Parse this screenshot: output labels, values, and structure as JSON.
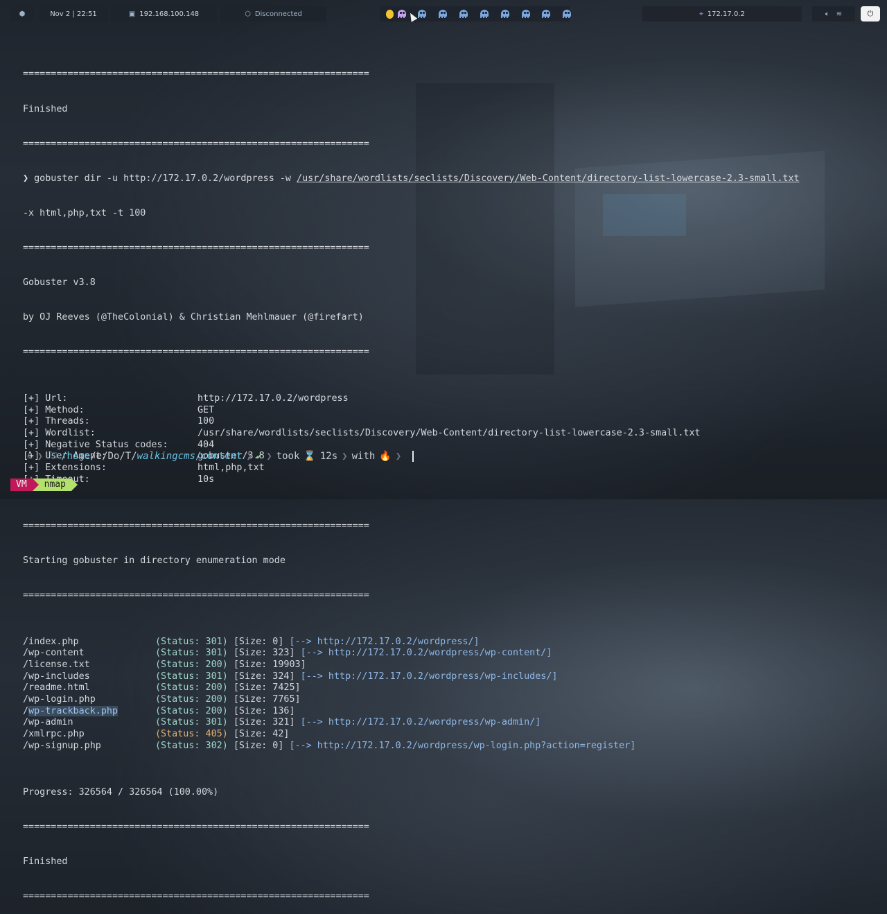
{
  "topbar": {
    "os_icon": "cube-icon",
    "datetime": "Nov 2 | 22:51",
    "host_ip": "192.168.100.148",
    "vpn_status": "Disconnected",
    "target_ip": "172.17.0.2",
    "workspaces_count": 10,
    "active_workspace_index": 1
  },
  "terminal": {
    "sep": "==============================================================",
    "finished_label": "Finished",
    "command_prompt": "❯",
    "command_part1": "gobuster dir -u http://172.17.0.2/wordpress -w ",
    "command_wordlist": "/usr/share/wordlists/seclists/Discovery/Web-Content/directory-list-lowercase-2.3-small.txt",
    "command_part2": "-x html,php,txt -t 100",
    "version": "Gobuster v3.8",
    "authors": "by OJ Reeves (@TheColonial) & Christian Mehlmauer (@firefart)",
    "config": [
      {
        "key": "[+] Url:",
        "value": "http://172.17.0.2/wordpress"
      },
      {
        "key": "[+] Method:",
        "value": "GET"
      },
      {
        "key": "[+] Threads:",
        "value": "100"
      },
      {
        "key": "[+] Wordlist:",
        "value": "/usr/share/wordlists/seclists/Discovery/Web-Content/directory-list-lowercase-2.3-small.txt"
      },
      {
        "key": "[+] Negative Status codes:",
        "value": "404"
      },
      {
        "key": "[+] User Agent:",
        "value": "gobuster/3.8"
      },
      {
        "key": "[+] Extensions:",
        "value": "html,php,txt"
      },
      {
        "key": "[+] Timeout:",
        "value": "10s"
      }
    ],
    "start_msg": "Starting gobuster in directory enumeration mode",
    "results": [
      {
        "path": "/index.php",
        "status": "(Status: 301)",
        "size": "[Size: 0]",
        "redirect": "[--> http://172.17.0.2/wordpress/]",
        "warn": false
      },
      {
        "path": "/wp-content",
        "status": "(Status: 301)",
        "size": "[Size: 323]",
        "redirect": "[--> http://172.17.0.2/wordpress/wp-content/]",
        "warn": false
      },
      {
        "path": "/license.txt",
        "status": "(Status: 200)",
        "size": "[Size: 19903]",
        "redirect": "",
        "warn": false
      },
      {
        "path": "/wp-includes",
        "status": "(Status: 301)",
        "size": "[Size: 324]",
        "redirect": "[--> http://172.17.0.2/wordpress/wp-includes/]",
        "warn": false
      },
      {
        "path": "/readme.html",
        "status": "(Status: 200)",
        "size": "[Size: 7425]",
        "redirect": "",
        "warn": false
      },
      {
        "path": "/wp-login.php",
        "status": "(Status: 200)",
        "size": "[Size: 7765]",
        "redirect": "",
        "warn": false
      },
      {
        "path_prefix": "/",
        "path_hl": "wp-trackback.php",
        "path": "/wp-trackback.php",
        "status": "(Status: 200)",
        "size": "[Size: 136]",
        "redirect": "",
        "warn": false
      },
      {
        "path": "/wp-admin",
        "status": "(Status: 301)",
        "size": "[Size: 321]",
        "redirect": "[--> http://172.17.0.2/wordpress/wp-admin/]",
        "warn": false
      },
      {
        "path": "/xmlrpc.php",
        "status": "(Status: 405)",
        "size": "[Size: 42]",
        "redirect": "",
        "warn": true
      },
      {
        "path": "/wp-signup.php",
        "status": "(Status: 302)",
        "size": "[Size: 0]",
        "redirect": "[--> http://172.17.0.2/wordpress/wp-login.php?action=register]",
        "warn": false
      }
    ],
    "progress": "Progress: 326564 / 326564 (100.00%)"
  },
  "prompt": {
    "os_icon": "penguin-icon",
    "folder_icon": "folder-icon",
    "dir_home": "/home",
    "dir_mid": "/e/Do/T/",
    "dir_walk": "walkingcms",
    "dir_last": "/content",
    "check": "✔",
    "took_label": "took",
    "hourglass": "⌛",
    "took_value": "12s",
    "with_label": "with",
    "fire": "🔥"
  },
  "tmux": {
    "session": "VM",
    "window": "nmap"
  },
  "colors": {
    "status_ok": "#9fd7c9",
    "status_warn": "#e0b070",
    "redirect": "#8fb8e6",
    "tmux_session": "#c2185b",
    "tmux_window": "#b4e06e"
  }
}
